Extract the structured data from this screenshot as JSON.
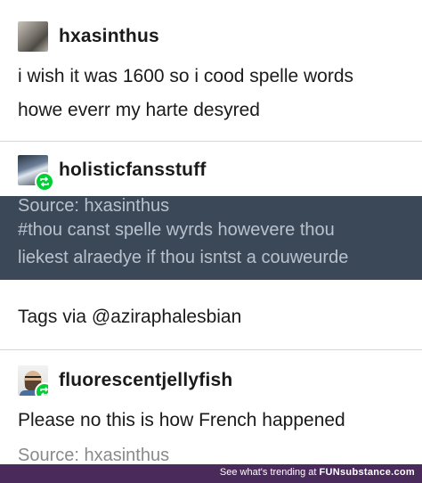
{
  "posts": [
    {
      "username": "hxasinthus",
      "lines": [
        "i wish it was 1600 so i cood spelle words",
        "howe everr my harte desyred"
      ]
    },
    {
      "username": "holisticfansstuff",
      "dark_lines": [
        "Source: hxasinthus",
        "#thou canst spelle wyrds howevere thou",
        "liekest alraedye if thou isntst a couweurde"
      ],
      "tags_line": "Tags via @aziraphalesbian"
    },
    {
      "username": "fluorescentjellyfish",
      "lines": [
        "Please no this is how French happened"
      ],
      "source_line": "Source: hxasinthus"
    }
  ],
  "footer": {
    "trending": "See what's trending at",
    "brand": "FUNsubstance.com"
  },
  "colors": {
    "dark_band": "#3b4858",
    "reblog_green": "#00cf35",
    "footer_bg": "#4a2a5a"
  },
  "icons": [
    "reblog-icon"
  ]
}
